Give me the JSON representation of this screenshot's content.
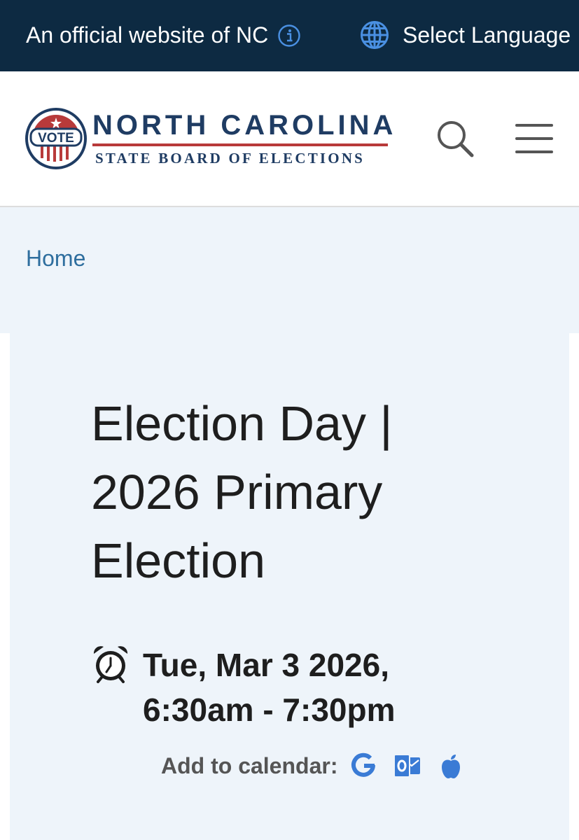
{
  "topbar": {
    "official_text": "An official website of NC",
    "info_icon": "info-circle-icon",
    "language_label": "Select Language",
    "globe_icon": "globe-icon",
    "background": "#0d2a42"
  },
  "header": {
    "logo": {
      "seal_text": "VOTE",
      "title": "NORTH CAROLINA",
      "subtitle": "STATE BOARD OF ELECTIONS"
    },
    "search_icon": "search-icon",
    "menu_icon": "hamburger-menu-icon"
  },
  "breadcrumb": {
    "home": "Home"
  },
  "event": {
    "title": "Election Day | 2026 Primary Election",
    "date_line1": "Tue, Mar 3 2026,",
    "date_line2": "6:30am - 7:30pm",
    "clock_icon": "alarm-clock-icon",
    "add_to_calendar": "Add to calendar:",
    "calendar_icons": [
      "google-icon",
      "outlook-icon",
      "apple-icon"
    ]
  },
  "colors": {
    "accent_blue": "#3a7bd5",
    "link_blue": "#2e6e9e",
    "logo_navy": "#1f3c63",
    "logo_red": "#b83a3a",
    "panel_bg": "#eef4fa"
  }
}
